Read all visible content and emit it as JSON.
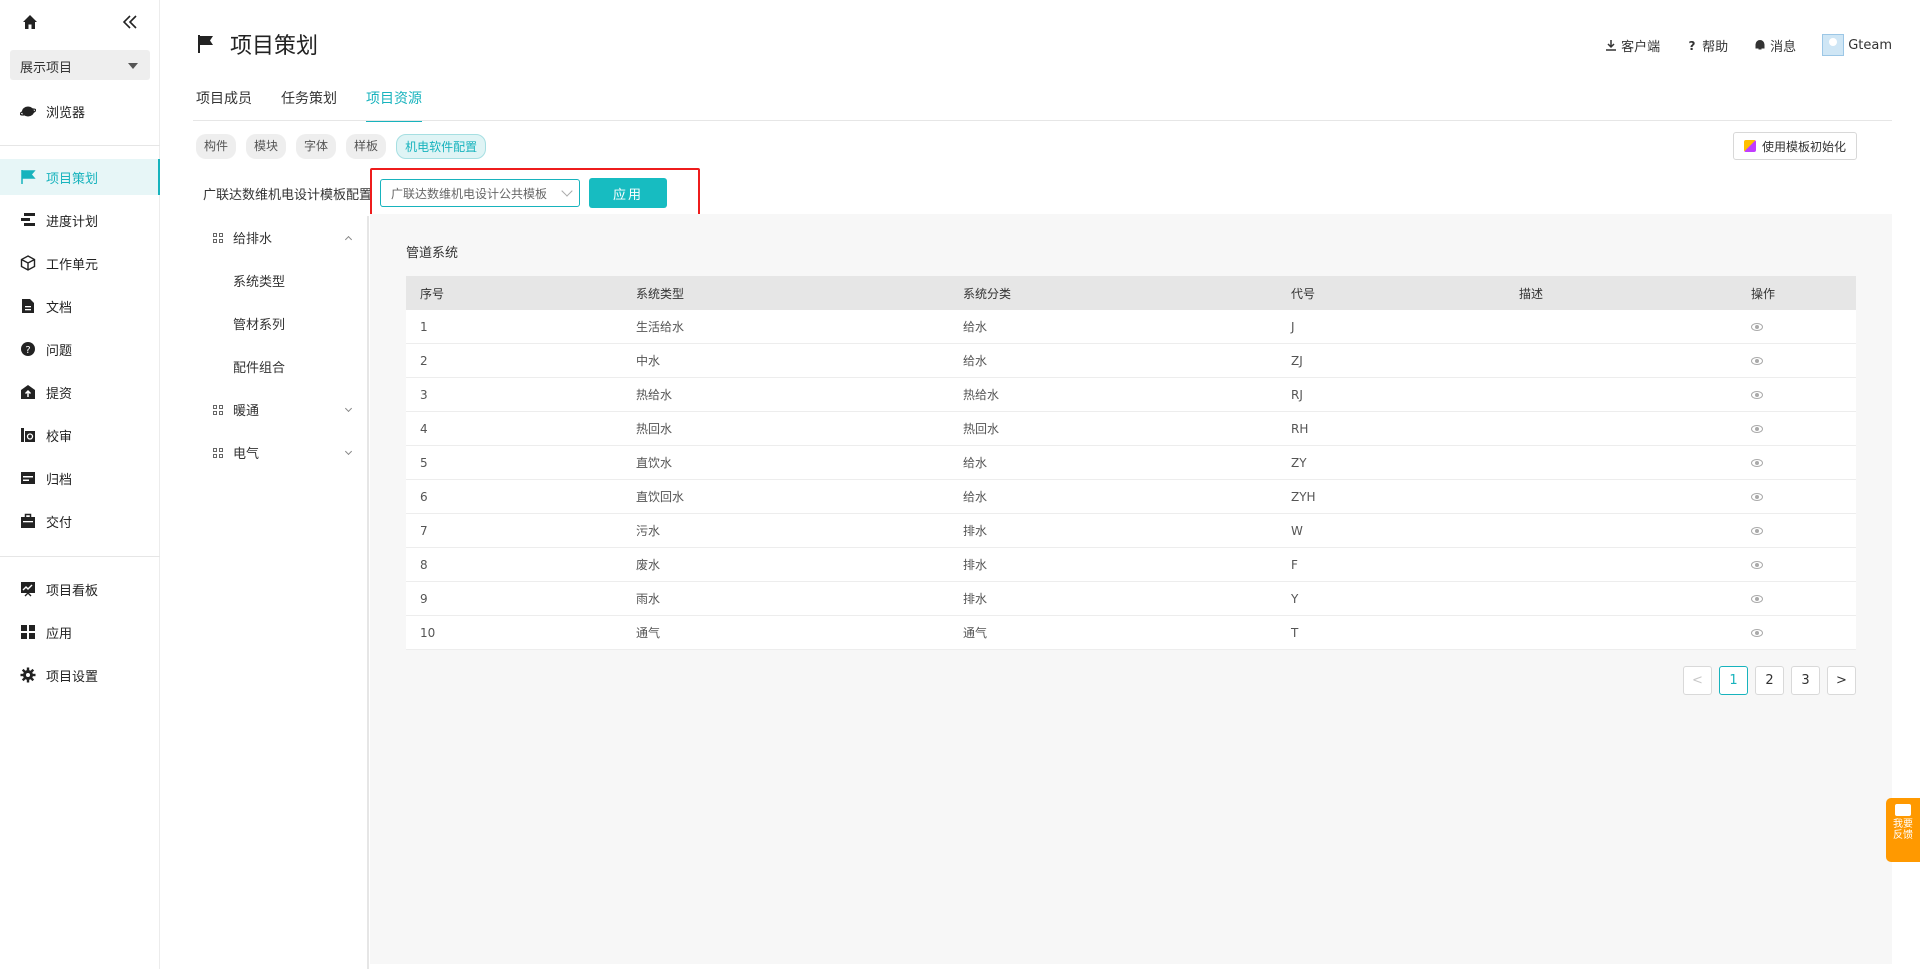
{
  "sidebar": {
    "project": "展示项目",
    "items": [
      {
        "label": "浏览器",
        "icon": "planet-icon"
      },
      {
        "label": "项目策划",
        "icon": "flag-icon",
        "active": true
      },
      {
        "label": "进度计划",
        "icon": "gantt-icon"
      },
      {
        "label": "工作单元",
        "icon": "cube-icon"
      },
      {
        "label": "文档",
        "icon": "document-icon"
      },
      {
        "label": "问题",
        "icon": "question-icon"
      },
      {
        "label": "提资",
        "icon": "submit-icon"
      },
      {
        "label": "校审",
        "icon": "review-icon"
      },
      {
        "label": "归档",
        "icon": "archive-icon"
      },
      {
        "label": "交付",
        "icon": "briefcase-icon"
      },
      {
        "label": "项目看板",
        "icon": "board-icon"
      },
      {
        "label": "应用",
        "icon": "apps-icon"
      },
      {
        "label": "项目设置",
        "icon": "gear-icon"
      }
    ]
  },
  "header": {
    "title": "项目策划",
    "client": "客户端",
    "help": "帮助",
    "messages": "消息",
    "user": "Gteam"
  },
  "tabs": [
    "项目成员",
    "任务策划",
    "项目资源"
  ],
  "chips": [
    "构件",
    "模块",
    "字体",
    "样板",
    "机电软件配置"
  ],
  "init_button": "使用模板初始化",
  "config": {
    "label": "广联达数维机电设计模板配置",
    "selected": "广联达数维机电设计公共模板",
    "apply": "应用"
  },
  "tree": [
    {
      "label": "给排水",
      "type": "group",
      "expanded": true
    },
    {
      "label": "系统类型",
      "type": "sub"
    },
    {
      "label": "管材系列",
      "type": "sub"
    },
    {
      "label": "配件组合",
      "type": "sub"
    },
    {
      "label": "暖通",
      "type": "group",
      "expanded": false
    },
    {
      "label": "电气",
      "type": "group",
      "expanded": false
    }
  ],
  "panel": {
    "title": "管道系统",
    "columns": [
      "序号",
      "系统类型",
      "系统分类",
      "代号",
      "描述",
      "操作"
    ],
    "rows": [
      [
        "1",
        "生活给水",
        "给水",
        "J",
        ""
      ],
      [
        "2",
        "中水",
        "给水",
        "ZJ",
        ""
      ],
      [
        "3",
        "热给水",
        "热给水",
        "RJ",
        ""
      ],
      [
        "4",
        "热回水",
        "热回水",
        "RH",
        ""
      ],
      [
        "5",
        "直饮水",
        "给水",
        "ZY",
        ""
      ],
      [
        "6",
        "直饮回水",
        "给水",
        "ZYH",
        ""
      ],
      [
        "7",
        "污水",
        "排水",
        "W",
        ""
      ],
      [
        "8",
        "废水",
        "排水",
        "F",
        ""
      ],
      [
        "9",
        "雨水",
        "排水",
        "Y",
        ""
      ],
      [
        "10",
        "通气",
        "通气",
        "T",
        ""
      ]
    ]
  },
  "pagination": {
    "prev": "<",
    "pages": [
      "1",
      "2",
      "3"
    ],
    "current": "1",
    "next": ">"
  },
  "feedback": {
    "line1": "我要",
    "line2": "反馈"
  }
}
